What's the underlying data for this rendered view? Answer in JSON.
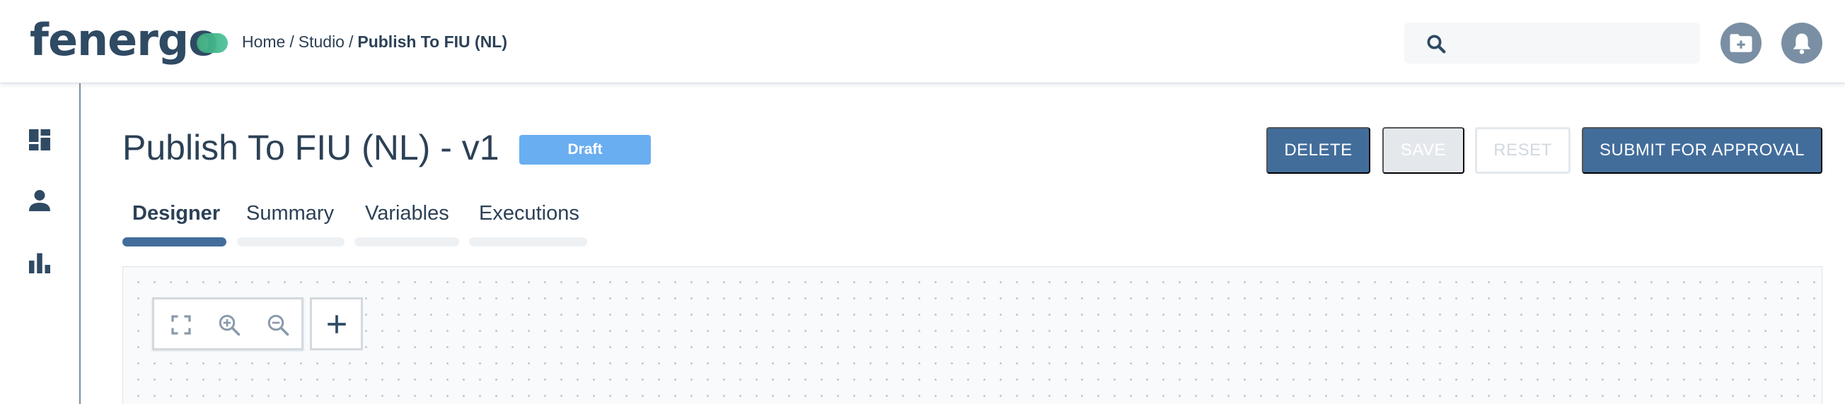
{
  "header": {
    "logo_text": "fenergo",
    "breadcrumb": {
      "home": "Home",
      "studio": "Studio",
      "current": "Publish To FIU (NL)",
      "separator": "/"
    },
    "search_placeholder": "",
    "icons": {
      "search": "search-icon",
      "add_folder": "folder-plus-icon",
      "notifications": "bell-icon"
    }
  },
  "sidebar": {
    "items": [
      {
        "icon": "dashboard-icon"
      },
      {
        "icon": "user-icon"
      },
      {
        "icon": "bar-chart-icon"
      }
    ]
  },
  "main": {
    "title": "Publish To FIU (NL) - v1",
    "status": "Draft",
    "actions": {
      "delete": "DELETE",
      "save": "SAVE",
      "reset": "RESET",
      "submit": "SUBMIT FOR APPROVAL"
    },
    "tabs": [
      {
        "label": "Designer",
        "active": true
      },
      {
        "label": "Summary",
        "active": false
      },
      {
        "label": "Variables",
        "active": false
      },
      {
        "label": "Executions",
        "active": false
      }
    ],
    "canvas_controls": {
      "fit": "fit-screen-icon",
      "zoom_in": "zoom-in-icon",
      "zoom_out": "zoom-out-icon",
      "add": "plus-icon"
    }
  },
  "colors": {
    "primary": "#426d9b",
    "text": "#2c4156",
    "badge": "#6aaef2",
    "disabled": "#e4e8ec",
    "icon_muted": "#7a8fa3",
    "logo_accent": "#3aa57a"
  }
}
